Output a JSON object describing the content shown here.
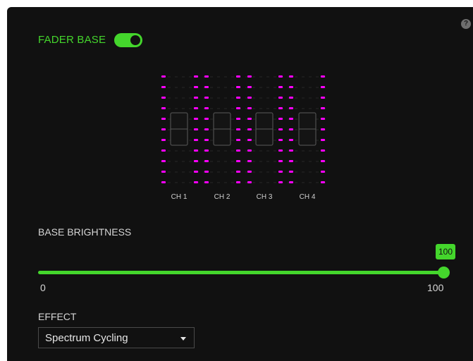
{
  "header": {
    "title": "FADER BASE",
    "toggle_on": true,
    "help_icon": "help-icon"
  },
  "fader_base": {
    "channels": [
      "CH 1",
      "CH 2",
      "CH 3",
      "CH 4"
    ],
    "led_color": "#ff00ff"
  },
  "brightness": {
    "label": "BASE BRIGHTNESS",
    "value": "100",
    "min_label": "0",
    "max_label": "100",
    "level": 1.0
  },
  "effect": {
    "label": "EFFECT",
    "selected": "Spectrum Cycling"
  },
  "colors": {
    "accent": "#44d62c",
    "panel_bg": "#111111"
  }
}
